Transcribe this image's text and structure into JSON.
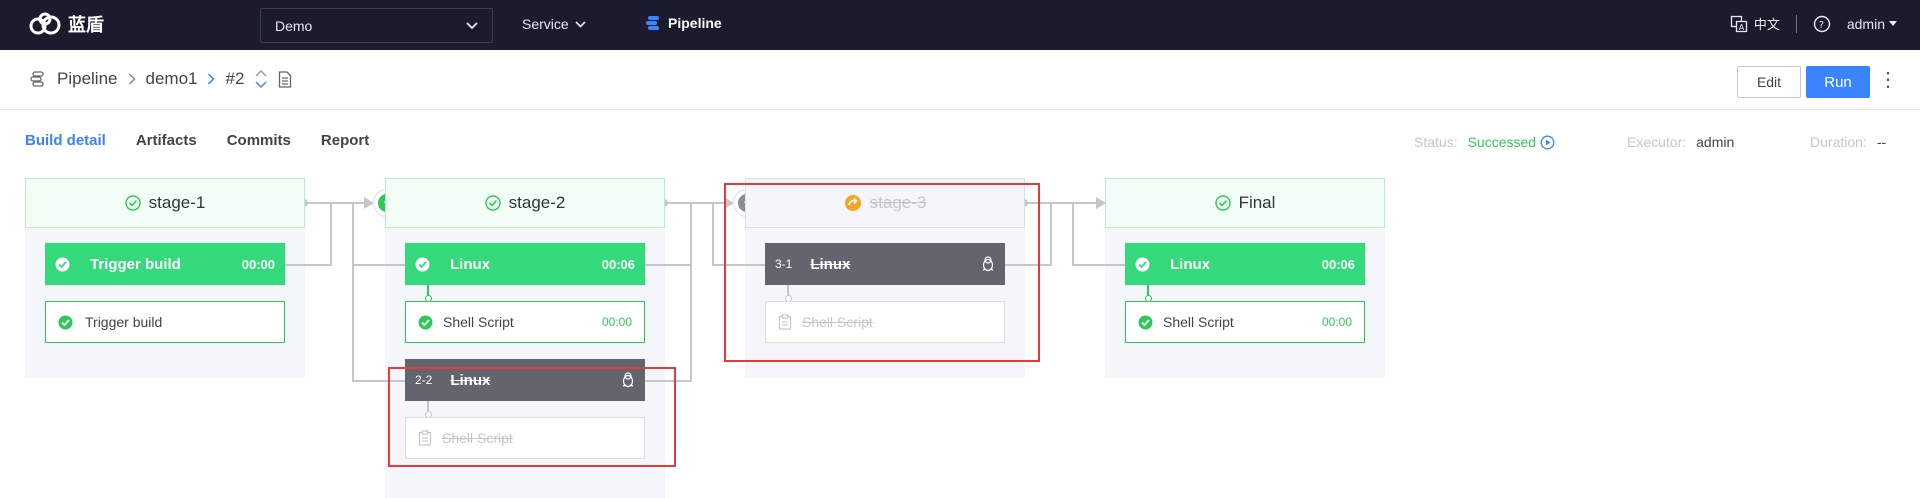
{
  "topbar": {
    "logo_text": "蓝盾",
    "project": "Demo",
    "service_label": "Service",
    "pipeline_label": "Pipeline",
    "lang_label": "中文",
    "user": "admin"
  },
  "breadcrumb": {
    "pipeline": "Pipeline",
    "name": "demo1",
    "build": "#2"
  },
  "actions": {
    "edit": "Edit",
    "run": "Run"
  },
  "tabs": [
    {
      "label": "Build detail",
      "active": true
    },
    {
      "label": "Artifacts"
    },
    {
      "label": "Commits"
    },
    {
      "label": "Report"
    }
  ],
  "meta": {
    "status_label": "Status:",
    "status_value": "Successed",
    "executor_label": "Executor:",
    "executor_value": "admin",
    "duration_label": "Duration:",
    "duration_value": "--"
  },
  "stages": [
    {
      "name": "stage-1",
      "status": "success",
      "job": {
        "name": "Trigger build",
        "time": "00:00"
      },
      "task": {
        "name": "Trigger build"
      }
    },
    {
      "name": "stage-2",
      "status": "success",
      "jobs": [
        {
          "name": "Linux",
          "time": "00:06",
          "task": "Shell Script",
          "task_time": "00:00"
        },
        {
          "num": "2-2",
          "name": "Linux",
          "task": "Shell Script",
          "skipped": true
        }
      ]
    },
    {
      "name": "stage-3",
      "status": "skipped",
      "job": {
        "num": "3-1",
        "name": "Linux",
        "task": "Shell Script"
      }
    },
    {
      "name": "Final",
      "status": "success",
      "job": {
        "name": "Linux",
        "time": "00:06",
        "task": "Shell Script",
        "task_time": "00:00"
      }
    }
  ],
  "colors": {
    "topbar": "#1a1c2e",
    "accent": "#3a84ff",
    "success": "#34d97b",
    "skipped_job": "#63656e",
    "highlight_box": "#e23b3b",
    "trigger_skip": "#f6a623"
  }
}
